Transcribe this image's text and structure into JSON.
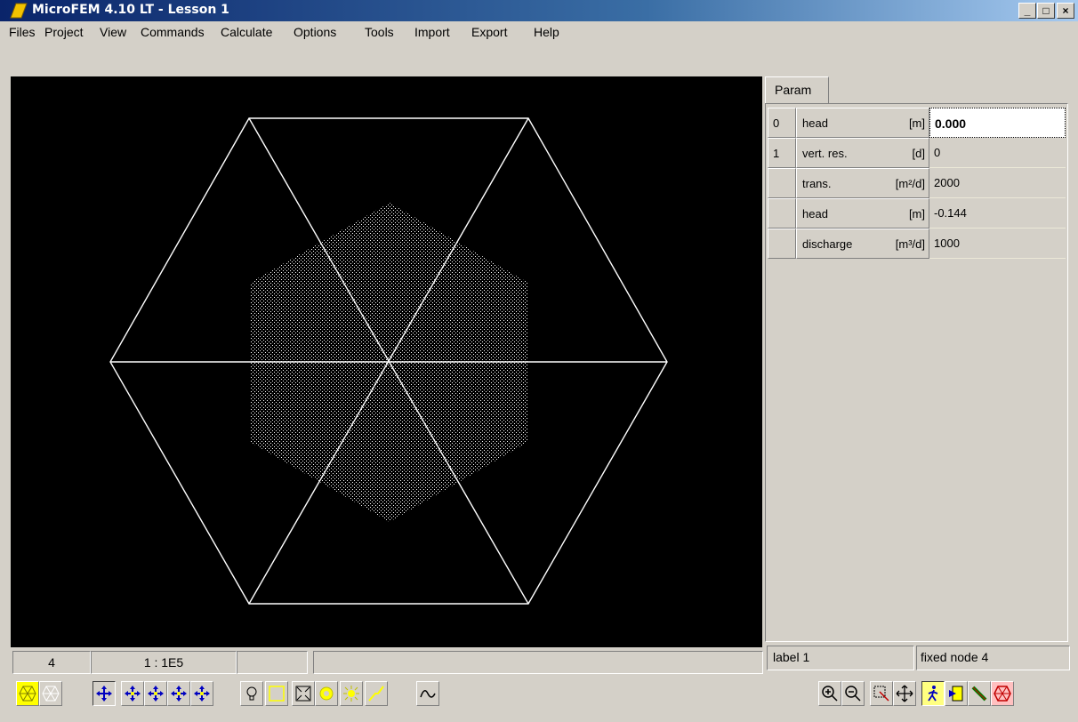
{
  "window": {
    "title": "MicroFEM 4.10 LT - Lesson 1"
  },
  "menu": [
    "Files",
    "Project",
    "View",
    "Commands",
    "Calculate",
    "Options",
    "Tools",
    "Import",
    "Export",
    "Help"
  ],
  "panel": {
    "tab": "Param",
    "rows": [
      {
        "idx": "0",
        "name": "head",
        "unit": "[m]",
        "value": "0.000"
      },
      {
        "idx": "1",
        "name": "vert. res.",
        "unit": "[d]",
        "value": "0"
      },
      {
        "idx": "",
        "name": "trans.",
        "unit": "[m²/d]",
        "value": "2000"
      },
      {
        "idx": "",
        "name": "head",
        "unit": "[m]",
        "value": "-0.144"
      },
      {
        "idx": "",
        "name": "discharge",
        "unit": "[m³/d]",
        "value": "1000"
      }
    ]
  },
  "status": {
    "layer": "4",
    "scale": "1 : 1E5",
    "empty1": "",
    "empty2": "",
    "label": "label 1",
    "node": "fixed node 4"
  },
  "colors": {
    "canvas": "#000000",
    "mesh": "#ffffff",
    "titlebar": "#0a246a",
    "highlight": "#ffff00"
  },
  "toolbar_left": [
    "mesh-yellow-icon",
    "mesh-white-icon",
    "move-icon",
    "move-icon",
    "move-icon",
    "move-icon",
    "bulb-icon",
    "rectangle-icon",
    "fit-icon",
    "sun-dim-icon",
    "sun-icon",
    "line-icon",
    "curve-icon"
  ],
  "toolbar_right": [
    "zoom-in-icon",
    "zoom-out-icon",
    "zoom-select-icon",
    "pan-icon",
    "walk-icon",
    "label-icon",
    "pencil-icon",
    "wheel-icon"
  ]
}
